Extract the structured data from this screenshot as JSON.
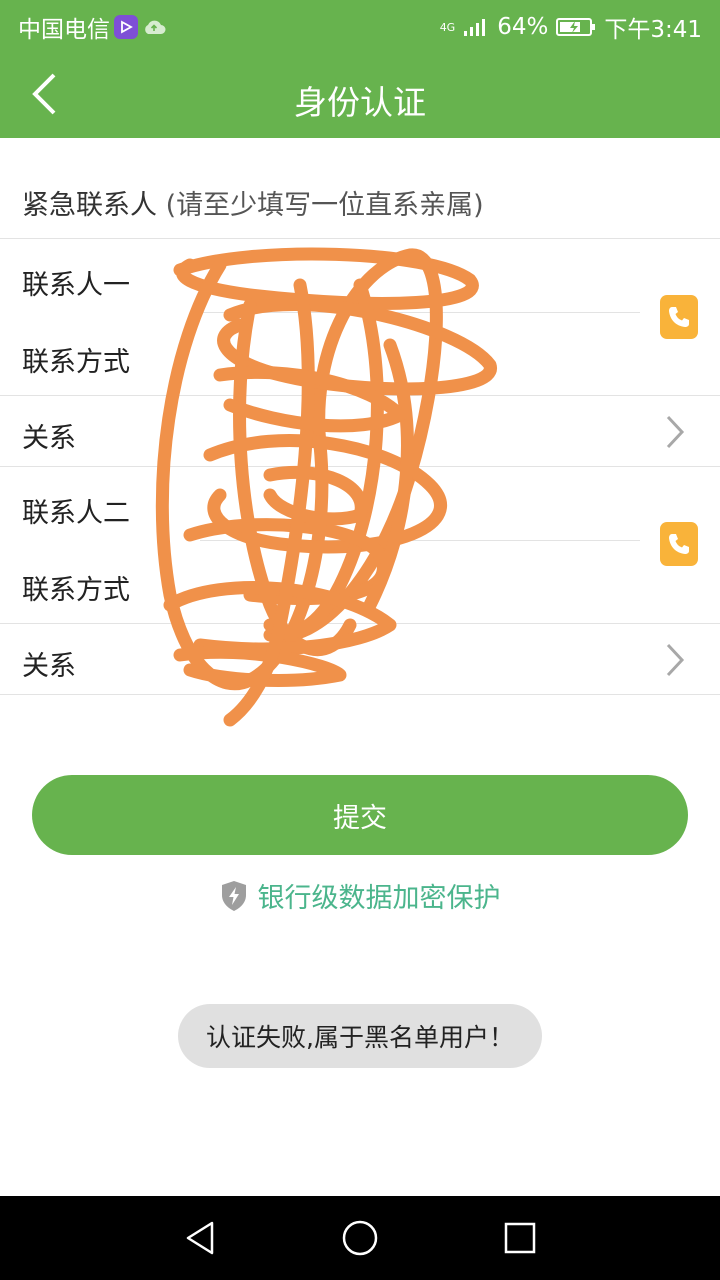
{
  "status_bar": {
    "carrier": "中国电信",
    "network": "4G",
    "battery": "64%",
    "time": "下午3:41"
  },
  "header": {
    "title": "身份认证",
    "back_icon": "chevron-left-icon"
  },
  "section": {
    "title": "紧急联系人",
    "hint": " (请至少填写一位直系亲属)"
  },
  "contacts": [
    {
      "name_label": "联系人一",
      "phone_label": "联系方式",
      "relation_label": "关系"
    },
    {
      "name_label": "联系人二",
      "phone_label": "联系方式",
      "relation_label": "关系"
    }
  ],
  "submit_label": "提交",
  "secure_text": "银行级数据加密保护",
  "toast_text": "认证失败,属于黑名单用户！",
  "colors": {
    "primary": "#67b34e",
    "accent_phone": "#f9b33a",
    "secure_text": "#4bb58c",
    "scribble": "#f0914a"
  }
}
